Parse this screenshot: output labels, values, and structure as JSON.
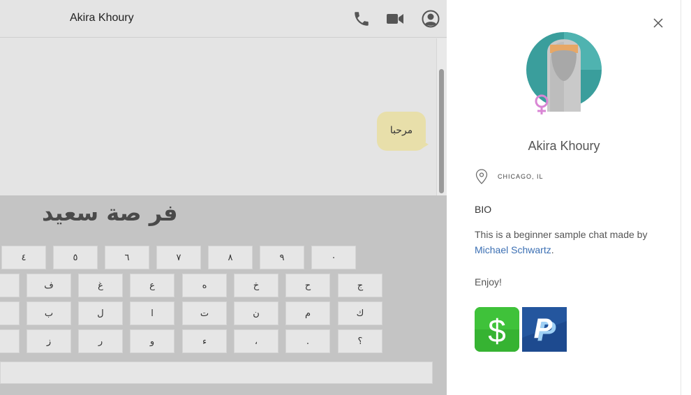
{
  "chat": {
    "contact_name": "Akira Khoury",
    "icons": {
      "call": "phone-icon",
      "video": "video-camera-icon",
      "profile": "user-circle-icon"
    },
    "messages": [
      {
        "text": "مرحبا",
        "bubble_color": "#e8dfaa"
      }
    ]
  },
  "keyboard": {
    "input_text": "فر صة سعيد",
    "rows": [
      [
        "٤",
        "٥",
        "٦",
        "٧",
        "٨",
        "٩",
        "٠"
      ],
      [
        "ف",
        "غ",
        "ع",
        "ه",
        "خ",
        "ح",
        "ج"
      ],
      [
        "ب",
        "ل",
        "ا",
        "ت",
        "ن",
        "م",
        "ك"
      ],
      [
        "ز",
        "ر",
        "و",
        "ء",
        "،",
        ".",
        "؟"
      ]
    ]
  },
  "profile": {
    "name": "Akira Khoury",
    "location": "CHICAGO, IL",
    "bio_heading": "BIO",
    "bio_text": "This is a beginner sample chat made by ",
    "bio_link": "Michael Schwartz",
    "bio_suffix": ".",
    "enjoy": "Enjoy!",
    "payment": {
      "cash_symbol": "$",
      "paypal_symbol": "P"
    },
    "colors": {
      "link": "#3b6fb3",
      "cash_green": "#3fc23a",
      "paypal_blue": "#1d4a8f",
      "avatar_teal": "#3a9e9c",
      "female_symbol": "#d986d4"
    }
  }
}
